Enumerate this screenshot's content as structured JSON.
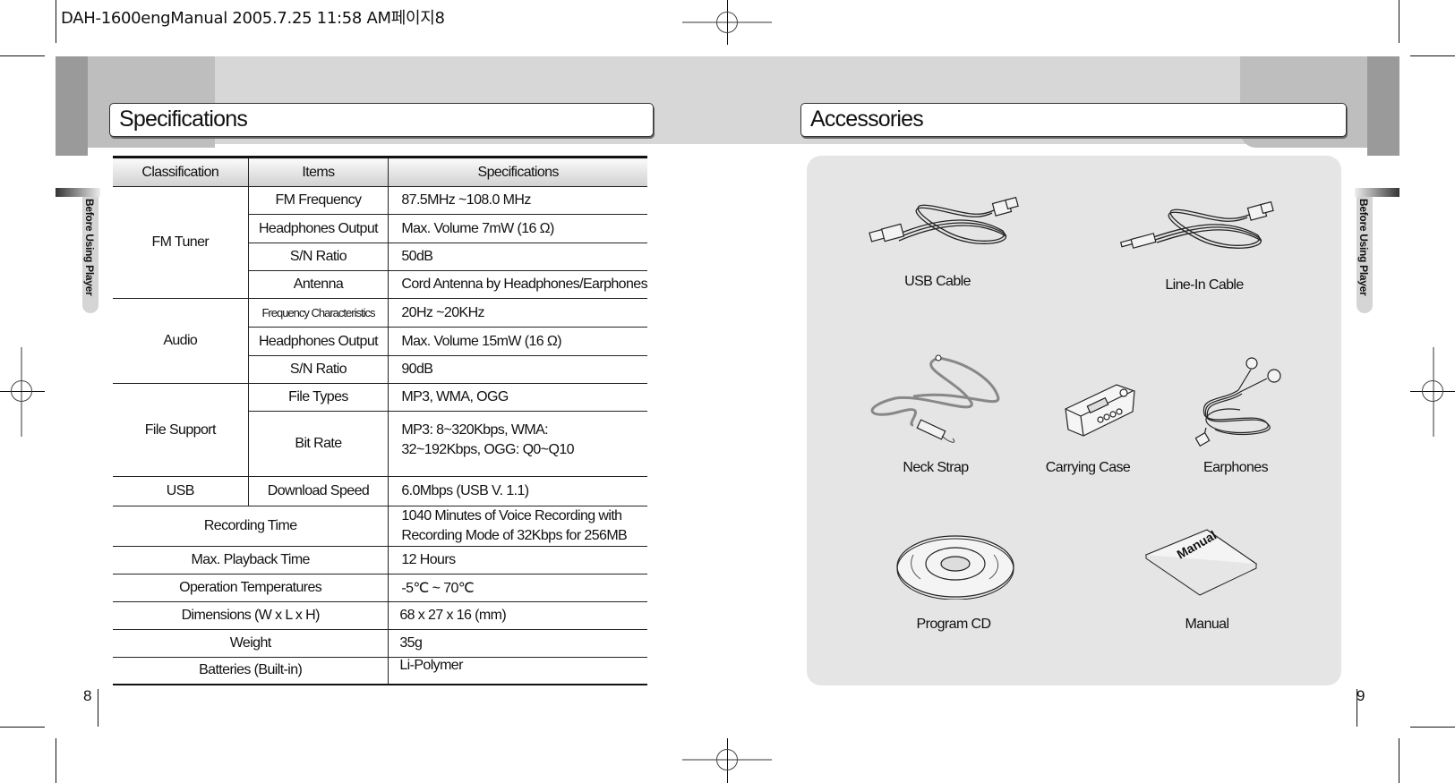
{
  "print_header": "DAH-1600engManual  2005.7.25 11:58 AM페이지8",
  "left_page": {
    "title": "Specifications",
    "side_tab": "Before Using Player",
    "page_number": "8",
    "table": {
      "headers": [
        "Classification",
        "Items",
        "Specifications"
      ],
      "groups": [
        {
          "classification": "FM Tuner",
          "rows": [
            {
              "item": "FM Frequency",
              "spec": "87.5MHz ~108.0 MHz"
            },
            {
              "item": "Headphones Output",
              "spec": "Max. Volume 7mW (16 Ω)"
            },
            {
              "item": "S/N Ratio",
              "spec": "50dB"
            },
            {
              "item": "Antenna",
              "spec": "Cord Antenna by Headphones/Earphones"
            }
          ]
        },
        {
          "classification": "Audio",
          "rows": [
            {
              "item": "Frequency Characteristics",
              "spec": "20Hz ~20KHz"
            },
            {
              "item": "Headphones Output",
              "spec": "Max. Volume 15mW (16 Ω)"
            },
            {
              "item": "S/N Ratio",
              "spec": "90dB"
            }
          ]
        },
        {
          "classification": "File Support",
          "rows": [
            {
              "item": "File Types",
              "spec": "MP3, WMA, OGG"
            },
            {
              "item": "Bit Rate",
              "spec_line1": "MP3: 8~320Kbps, WMA:",
              "spec_line2": "32~192Kbps, OGG: Q0~Q10"
            }
          ]
        },
        {
          "classification": "USB",
          "rows": [
            {
              "item": "Download Speed",
              "spec": "6.0Mbps (USB V. 1.1)"
            }
          ]
        }
      ],
      "single_rows": [
        {
          "item": "Recording Time",
          "spec_line1": "1040 Minutes of Voice Recording with",
          "spec_line2": "Recording Mode of 32Kbps for 256MB"
        },
        {
          "item": "Max. Playback Time",
          "spec": "12 Hours"
        },
        {
          "item": "Operation Temperatures",
          "spec": "-5℃ ~ 70℃"
        },
        {
          "item": "Dimensions (W x L x H)",
          "spec": "68 x 27 x 16 (mm)"
        },
        {
          "item": "Weight",
          "spec": "35g"
        },
        {
          "item": "Batteries (Built-in)",
          "spec": "Li-Polymer"
        }
      ]
    }
  },
  "right_page": {
    "title": "Accessories",
    "side_tab": "Before Using Player",
    "page_number": "9",
    "items": [
      {
        "label": "USB Cable",
        "icon": "usb-cable-icon"
      },
      {
        "label": "Line-In Cable",
        "icon": "line-in-cable-icon"
      },
      {
        "label": "Neck Strap",
        "icon": "neck-strap-icon"
      },
      {
        "label": "Carrying Case",
        "icon": "carrying-case-icon"
      },
      {
        "label": "Earphones",
        "icon": "earphones-icon"
      },
      {
        "label": "Program CD",
        "icon": "program-cd-icon"
      },
      {
        "label": "Manual",
        "icon": "manual-icon",
        "cover_text": "Manual"
      }
    ]
  }
}
